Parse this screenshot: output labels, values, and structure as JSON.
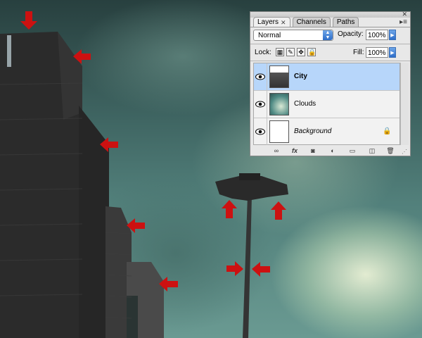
{
  "layers_panel": {
    "tabs": [
      {
        "label": "Layers",
        "active": true
      },
      {
        "label": "Channels",
        "active": false
      },
      {
        "label": "Paths",
        "active": false
      }
    ],
    "blend_mode": "Normal",
    "opacity_label": "Opacity:",
    "opacity_value": "100%",
    "lock_label": "Lock:",
    "fill_label": "Fill:",
    "fill_value": "100%",
    "layers": [
      {
        "name": "City",
        "selected": true,
        "visible": true
      },
      {
        "name": "Clouds",
        "selected": false,
        "visible": true
      },
      {
        "name": "Background",
        "selected": false,
        "visible": true,
        "locked": true
      }
    ],
    "bottom_icons": [
      "link-layers-icon",
      "layer-style-icon",
      "layer-mask-icon",
      "adjustment-layer-icon",
      "group-folder-icon",
      "new-layer-icon",
      "trash-icon"
    ]
  },
  "colors": {
    "selection_highlight": "#b7d6fa",
    "arrow_red": "#cc1111",
    "panel_bg": "#e8e8e8"
  },
  "canvas": {
    "annotation": "red arrow markers pointing at building edges and lamp post"
  }
}
